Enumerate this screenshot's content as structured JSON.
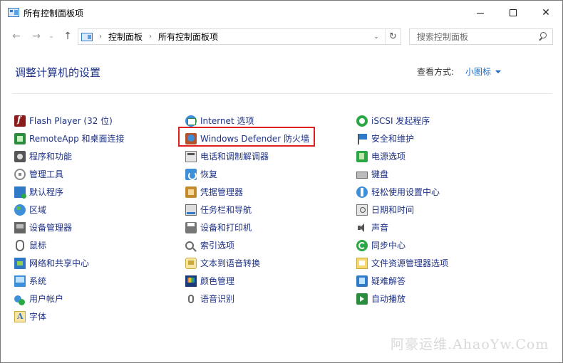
{
  "window": {
    "title": "所有控制面板项"
  },
  "nav": {
    "breadcrumbs": [
      "控制面板",
      "所有控制面板项"
    ],
    "separator": "›"
  },
  "search": {
    "placeholder": "搜索控制面板"
  },
  "header": {
    "title": "调整计算机的设置",
    "view_label": "查看方式:",
    "view_value": "小图标"
  },
  "columns": [
    [
      {
        "label": "Flash Player (32 位)",
        "icon": "flash-icon"
      },
      {
        "label": "RemoteApp 和桌面连接",
        "icon": "remoteapp-icon"
      },
      {
        "label": "程序和功能",
        "icon": "programs-icon"
      },
      {
        "label": "管理工具",
        "icon": "admin-tools-icon"
      },
      {
        "label": "默认程序",
        "icon": "default-programs-icon"
      },
      {
        "label": "区域",
        "icon": "region-icon"
      },
      {
        "label": "设备管理器",
        "icon": "device-manager-icon"
      },
      {
        "label": "鼠标",
        "icon": "mouse-icon"
      },
      {
        "label": "网络和共享中心",
        "icon": "network-icon"
      },
      {
        "label": "系统",
        "icon": "system-icon"
      },
      {
        "label": "用户帐户",
        "icon": "users-icon"
      },
      {
        "label": "字体",
        "icon": "fonts-icon"
      }
    ],
    [
      {
        "label": "Internet 选项",
        "icon": "internet-options-icon"
      },
      {
        "label": "Windows Defender 防火墙",
        "icon": "firewall-icon"
      },
      {
        "label": "电话和调制解调器",
        "icon": "phone-modem-icon"
      },
      {
        "label": "恢复",
        "icon": "recovery-icon"
      },
      {
        "label": "凭据管理器",
        "icon": "credential-icon"
      },
      {
        "label": "任务栏和导航",
        "icon": "taskbar-icon"
      },
      {
        "label": "设备和打印机",
        "icon": "printers-icon"
      },
      {
        "label": "索引选项",
        "icon": "indexing-icon"
      },
      {
        "label": "文本到语音转换",
        "icon": "tts-icon"
      },
      {
        "label": "颜色管理",
        "icon": "color-icon"
      },
      {
        "label": "语音识别",
        "icon": "speech-icon"
      }
    ],
    [
      {
        "label": "iSCSI 发起程序",
        "icon": "iscsi-icon"
      },
      {
        "label": "安全和维护",
        "icon": "security-flag-icon"
      },
      {
        "label": "电源选项",
        "icon": "power-icon"
      },
      {
        "label": "键盘",
        "icon": "keyboard-icon"
      },
      {
        "label": "轻松使用设置中心",
        "icon": "ease-of-access-icon"
      },
      {
        "label": "日期和时间",
        "icon": "datetime-icon"
      },
      {
        "label": "声音",
        "icon": "sound-icon"
      },
      {
        "label": "同步中心",
        "icon": "sync-icon"
      },
      {
        "label": "文件资源管理器选项",
        "icon": "explorer-options-icon"
      },
      {
        "label": "疑难解答",
        "icon": "troubleshoot-icon"
      },
      {
        "label": "自动播放",
        "icon": "autoplay-icon"
      }
    ]
  ],
  "watermark": "阿豪运维.AhaoYw.Com",
  "colors": {
    "link": "#1e3287",
    "accent": "#1a66c2",
    "highlight": "#e02020"
  }
}
